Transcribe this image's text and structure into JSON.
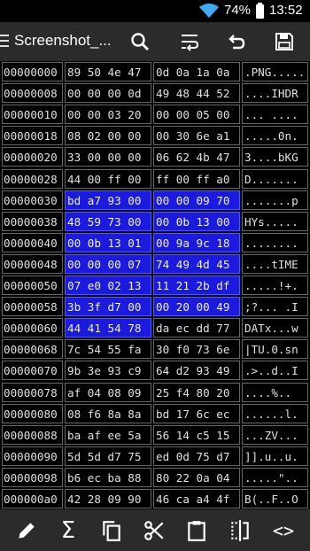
{
  "status_bar": {
    "battery_percent": "74%",
    "time": "13:52"
  },
  "toolbar": {
    "title": "Screenshot_...",
    "icons": [
      "menu-icon",
      "search-icon",
      "wrap-lines-icon",
      "undo-icon",
      "save-icon"
    ]
  },
  "hex_rows": [
    {
      "addr": "00000000",
      "h1": "89 50 4e 47",
      "h2": "0d 0a 1a 0a",
      "ascii": ".PNG....."
    },
    {
      "addr": "00000008",
      "h1": "00 00 00 0d",
      "h2": "49 48 44 52",
      "ascii": "....IHDR"
    },
    {
      "addr": "00000010",
      "h1": "00 00 03 20",
      "h2": "00 00 05 00",
      "ascii": "... ...."
    },
    {
      "addr": "00000018",
      "h1": "08 02 00 00",
      "h2": "00 30 6e a1",
      "ascii": ".....0n."
    },
    {
      "addr": "00000020",
      "h1": "33 00 00 00",
      "h2": "06 62 4b 47",
      "ascii": "3....bKG"
    },
    {
      "addr": "00000028",
      "h1": "44 00 ff 00",
      "h2": "ff 00 ff a0",
      "ascii": "D......."
    },
    {
      "addr": "00000030",
      "h1": "bd a7 93 00",
      "h2": "00 00 09 70",
      "ascii": ".......p"
    },
    {
      "addr": "00000038",
      "h1": "48 59 73 00",
      "h2": "00 0b 13 00",
      "ascii": "HYs....."
    },
    {
      "addr": "00000040",
      "h1": "00 0b 13 01",
      "h2": "00 9a 9c 18",
      "ascii": "........"
    },
    {
      "addr": "00000048",
      "h1": "00 00 00 07",
      "h2": "74 49 4d 45",
      "ascii": "....tIME"
    },
    {
      "addr": "00000050",
      "h1": "07 e0 02 13",
      "h2": "11 21 2b df",
      "ascii": ".....!+."
    },
    {
      "addr": "00000058",
      "h1": "3b 3f d7 00",
      "h2": "00 20 00 49",
      "ascii": ";?... .I"
    },
    {
      "addr": "00000060",
      "h1": "44 41 54 78",
      "h2": "da ec dd 77",
      "ascii": "DATx...w"
    },
    {
      "addr": "00000068",
      "h1": "7c 54 55 fa",
      "h2": "30 f0 73 6e",
      "ascii": "|TU.0.sn"
    },
    {
      "addr": "00000070",
      "h1": "9b 3e 93 c9",
      "h2": "64 d2 93 49",
      "ascii": ".>..d..I"
    },
    {
      "addr": "00000078",
      "h1": "af 04 08 09",
      "h2": "25 f4 80 20",
      "ascii": "....%.. "
    },
    {
      "addr": "00000080",
      "h1": "08 f6 8a 8a",
      "h2": "bd 17 6c ec",
      "ascii": "......l."
    },
    {
      "addr": "00000088",
      "h1": "ba af ee 5a",
      "h2": "56 14 c5 15",
      "ascii": "...ZV..."
    },
    {
      "addr": "00000090",
      "h1": "5d 5d d7 75",
      "h2": "ed 0d 75 d7",
      "ascii": "]].u..u."
    },
    {
      "addr": "00000098",
      "h1": "b6 ec ba 88",
      "h2": "80 22 0a 04",
      "ascii": ".....\".."
    },
    {
      "addr": "000000a0",
      "h1": "42 28 09 90",
      "h2": "46 ca a4 4f",
      "ascii": "B(..F..O"
    }
  ],
  "selection": {
    "h1_selected_rows": [
      6,
      7,
      8,
      9,
      10,
      11,
      12
    ],
    "h2_selected_rows": [
      6,
      7,
      8,
      9,
      10,
      11
    ]
  },
  "bottom_bar": {
    "icons": [
      "pencil-icon",
      "sigma-icon",
      "copy-icon",
      "cut-icon",
      "paste-icon",
      "split-icon",
      "code-icon"
    ],
    "sigma": "Σ",
    "code": "<>"
  },
  "colors": {
    "selection": "#1b1be0",
    "toolbar": "#2b2b2b",
    "wifi": "#3fa9f5"
  }
}
